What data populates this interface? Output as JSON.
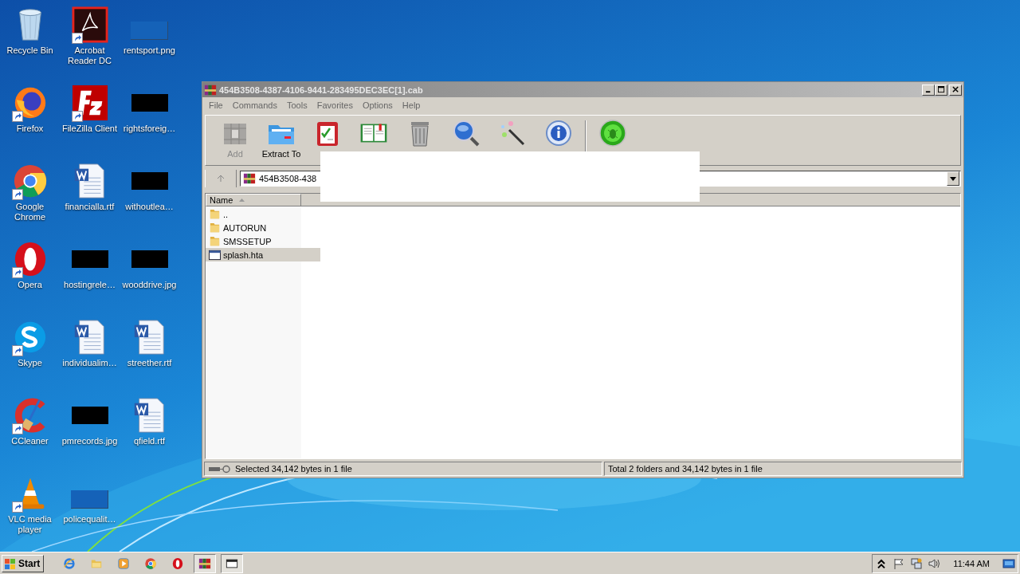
{
  "desktop_icons": [
    {
      "label": "Recycle Bin",
      "kind": "recycle-bin",
      "shortcut": false
    },
    {
      "label": "Firefox",
      "kind": "firefox",
      "shortcut": true
    },
    {
      "label": "Google Chrome",
      "kind": "chrome",
      "shortcut": true
    },
    {
      "label": "Opera",
      "kind": "opera",
      "shortcut": true
    },
    {
      "label": "Skype",
      "kind": "skype",
      "shortcut": true
    },
    {
      "label": "CCleaner",
      "kind": "ccleaner",
      "shortcut": true
    },
    {
      "label": "VLC media player",
      "kind": "vlc",
      "shortcut": true
    },
    {
      "label": "Acrobat Reader DC",
      "kind": "acrobat",
      "shortcut": true
    },
    {
      "label": "FileZilla Client",
      "kind": "filezilla",
      "shortcut": true
    },
    {
      "label": "financialla.rtf",
      "kind": "document",
      "shortcut": false
    },
    {
      "label": "hostingrele…",
      "kind": "dark-thumbnail",
      "shortcut": false
    },
    {
      "label": "individualim…",
      "kind": "document",
      "shortcut": false
    },
    {
      "label": "pmrecords.jpg",
      "kind": "dark-thumbnail",
      "shortcut": false
    },
    {
      "label": "policequalit…",
      "kind": "blank-thumbnail",
      "shortcut": false
    },
    {
      "label": "rentsport.png",
      "kind": "blank-thumbnail",
      "shortcut": false
    },
    {
      "label": "rightsforeig…",
      "kind": "dark-thumbnail",
      "shortcut": false
    },
    {
      "label": "withoutlea…",
      "kind": "dark-thumbnail",
      "shortcut": false
    },
    {
      "label": "wooddrive.jpg",
      "kind": "dark-thumbnail",
      "shortcut": false
    },
    {
      "label": "streether.rtf",
      "kind": "document",
      "shortcut": false
    },
    {
      "label": "qfield.rtf",
      "kind": "document",
      "shortcut": false
    }
  ],
  "window": {
    "title": "454B3508-4387-4106-9441-283495DEC3EC[1].cab",
    "menu": [
      "File",
      "Commands",
      "Tools",
      "Favorites",
      "Options",
      "Help"
    ],
    "toolbar": [
      {
        "kind": "add",
        "label": "Add",
        "disabled": true
      },
      {
        "kind": "extract",
        "label": "Extract To",
        "disabled": false
      },
      {
        "kind": "test",
        "disabled": false
      },
      {
        "kind": "view",
        "disabled": false
      },
      {
        "kind": "delete",
        "disabled": false
      },
      {
        "kind": "find",
        "disabled": false
      },
      {
        "kind": "wizard",
        "disabled": false
      },
      {
        "kind": "info",
        "disabled": false
      },
      {
        "kind": "separator"
      },
      {
        "kind": "virus-scan",
        "disabled": false
      }
    ],
    "address": "454B3508-438",
    "columns": [
      "Name"
    ],
    "files": [
      {
        "name": "..",
        "kind": "folder",
        "selected": false
      },
      {
        "name": "AUTORUN",
        "kind": "folder",
        "selected": false
      },
      {
        "name": "SMSSETUP",
        "kind": "folder",
        "selected": false
      },
      {
        "name": "splash.hta",
        "kind": "application",
        "selected": true
      }
    ],
    "status_bar": {
      "selection": "Selected 34,142 bytes in 1 file",
      "total": "Total 2 folders and 34,142 bytes in 1 file"
    }
  },
  "taskbar": {
    "start": "Start",
    "items": [
      {
        "kind": "internet-explorer",
        "active": false
      },
      {
        "kind": "folder",
        "active": false
      },
      {
        "kind": "media-player",
        "active": false
      },
      {
        "kind": "chrome",
        "active": false
      },
      {
        "kind": "opera",
        "active": false
      },
      {
        "kind": "archive",
        "active": true
      },
      {
        "kind": "window",
        "active": true
      }
    ],
    "clock": "11:44 AM"
  }
}
